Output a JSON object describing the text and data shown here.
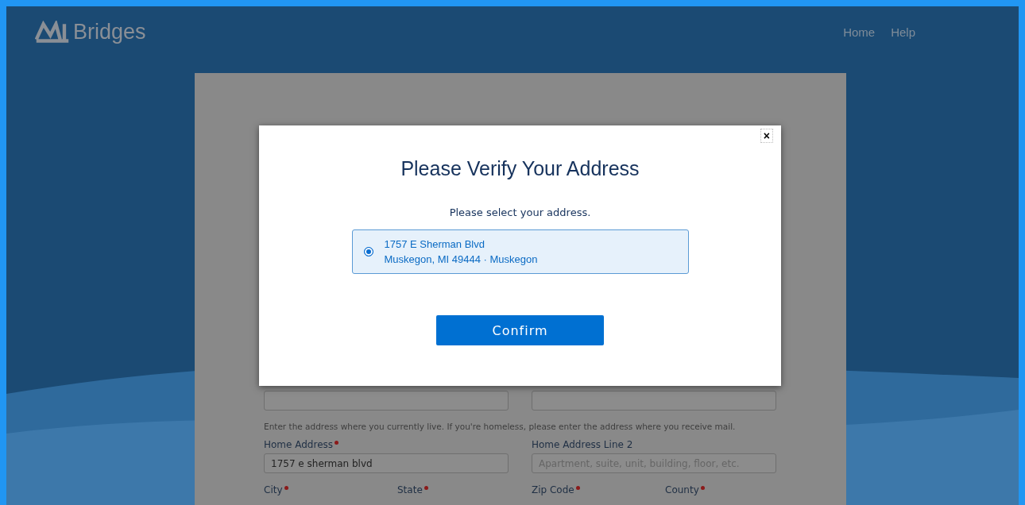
{
  "header": {
    "logo_text": "Bridges",
    "nav": [
      "Home",
      "Help"
    ]
  },
  "form": {
    "note": "Enter the address where you currently live. If you're homeless, please enter the address where you receive mail.",
    "address_fields": [
      {
        "label": "Home Address",
        "required": true,
        "value": "1757 e sherman blvd"
      },
      {
        "label": "Home Address Line 2",
        "placeholder": "Apartment, suite, unit, building, floor, etc."
      }
    ],
    "bottom_labels": [
      {
        "label": "City",
        "required": true
      },
      {
        "label": "State",
        "required": true
      },
      {
        "label": "Zip Code",
        "required": true
      },
      {
        "label": "County",
        "required": true
      }
    ]
  },
  "modal": {
    "close": "×",
    "title": "Please Verify Your Address",
    "subtitle": "Please select your address.",
    "options": [
      {
        "line1": "1757 E Sherman Blvd",
        "line2": "Muskegon, MI 49444 · Muskegon",
        "selected": true
      }
    ],
    "confirm": "Confirm"
  }
}
